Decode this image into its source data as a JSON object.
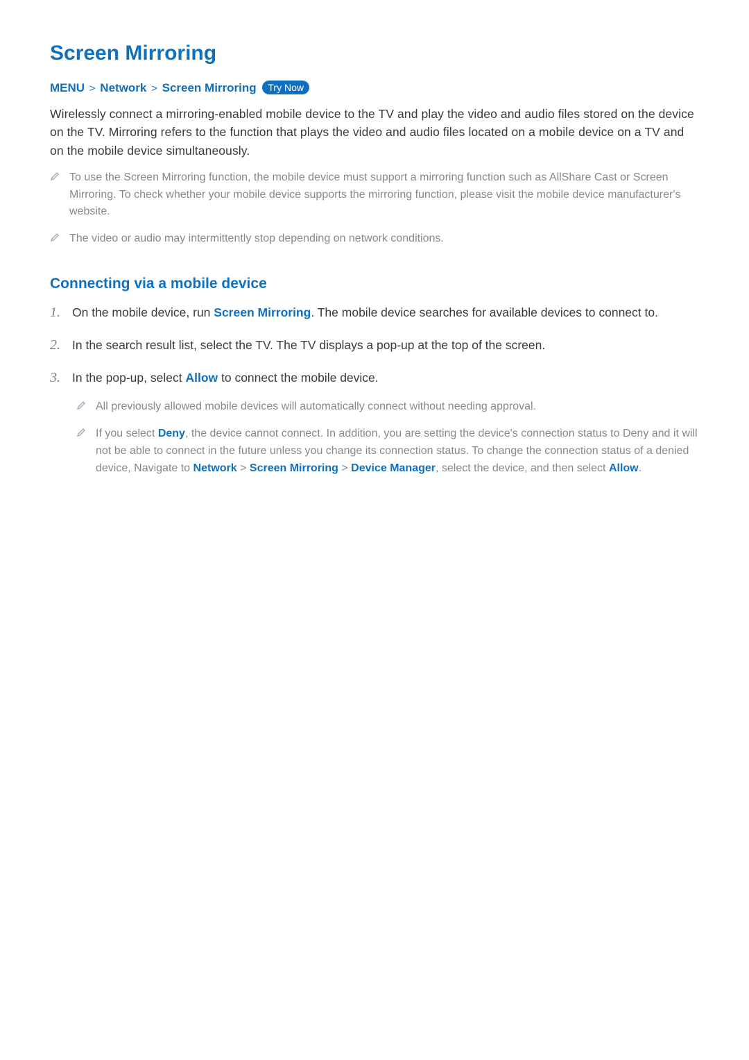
{
  "title": "Screen Mirroring",
  "breadcrumb": {
    "seg1": "MENU",
    "seg2": "Network",
    "seg3": "Screen Mirroring",
    "sep": ">",
    "try_now": "Try Now"
  },
  "intro": "Wirelessly connect a mirroring-enabled mobile device to the TV and play the video and audio files stored on the device on the TV. Mirroring refers to the function that plays the video and audio files located on a mobile device on a TV and on the mobile device simultaneously.",
  "notes": [
    "To use the Screen Mirroring function, the mobile device must support a mirroring function such as AllShare Cast or Screen Mirroring. To check whether your mobile device supports the mirroring function, please visit the mobile device manufacturer's website.",
    "The video or audio may intermittently stop depending on network conditions."
  ],
  "subheading": "Connecting via a mobile device",
  "steps": {
    "s1": {
      "pre": "On the mobile device, run ",
      "hl": "Screen Mirroring",
      "post": ". The mobile device searches for available devices to connect to."
    },
    "s2": "In the search result list, select the TV. The TV displays a pop-up at the top of the screen.",
    "s3": {
      "pre": "In the pop-up, select ",
      "hl": "Allow",
      "post": " to connect the mobile device."
    }
  },
  "subnotes": {
    "n1": "All previously allowed mobile devices will automatically connect without needing approval.",
    "n2": {
      "t1": "If you select ",
      "deny": "Deny",
      "t2": ", the device cannot connect. In addition, you are setting the device's connection status to Deny and it will not be able to connect in the future unless you change its connection status. To change the connection status of a denied device, Navigate to ",
      "network": "Network",
      "sep1": " > ",
      "sm": "Screen Mirroring",
      "sep2": " > ",
      "dm": "Device Manager",
      "t3": ", select the device, and then select ",
      "allow": "Allow",
      "t4": "."
    }
  }
}
